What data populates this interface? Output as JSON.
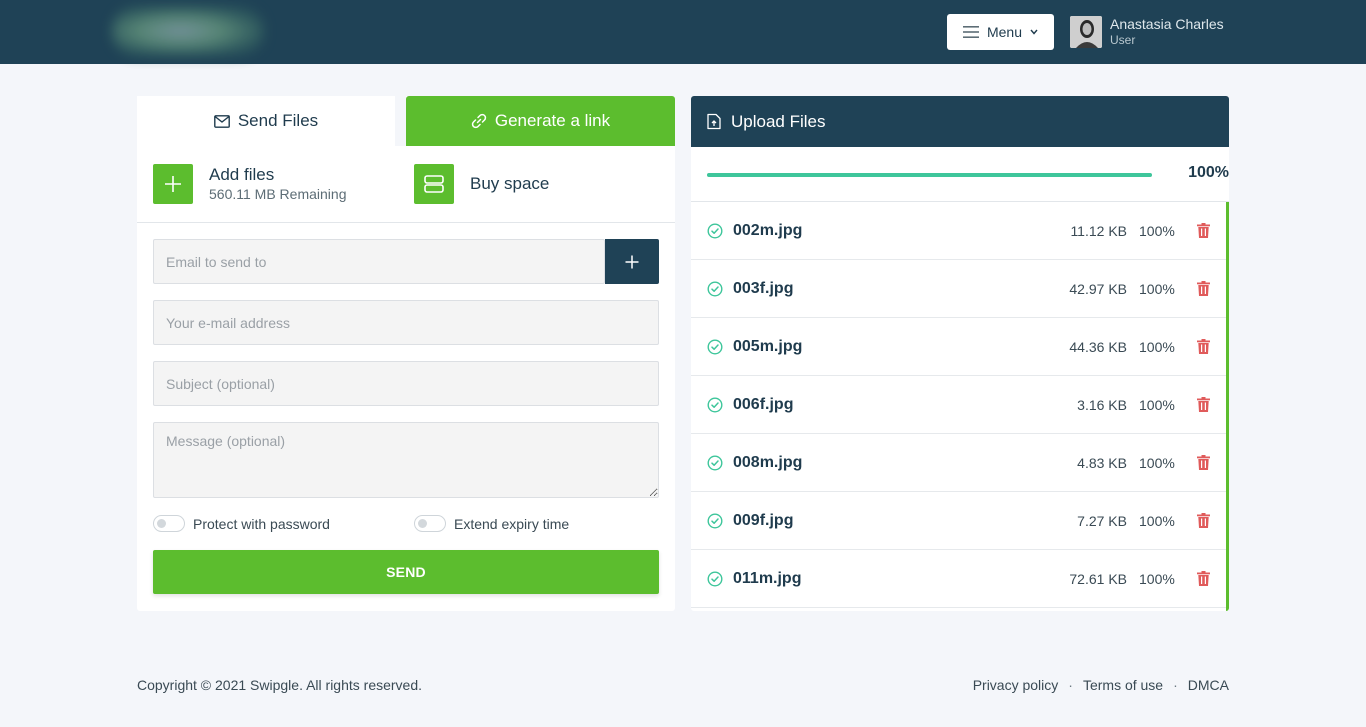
{
  "header": {
    "menu_label": "Menu",
    "user_name": "Anastasia Charles",
    "user_role": "User"
  },
  "send_panel": {
    "tab_send": "Send Files",
    "tab_link": "Generate a link",
    "add_files_title": "Add files",
    "add_files_remaining": "560.11 MB Remaining",
    "buy_space": "Buy space",
    "email_to_placeholder": "Email to send to",
    "your_email_placeholder": "Your e-mail address",
    "subject_placeholder": "Subject (optional)",
    "message_placeholder": "Message (optional)",
    "protect_password": "Protect with password",
    "extend_expiry": "Extend expiry time",
    "send_label": "SEND"
  },
  "upload_panel": {
    "title": "Upload Files",
    "progress_label": "100%",
    "progress_fraction": 1.0,
    "files": [
      {
        "name": "002m.jpg",
        "size": "11.12 KB",
        "pct": "100%"
      },
      {
        "name": "003f.jpg",
        "size": "42.97 KB",
        "pct": "100%"
      },
      {
        "name": "005m.jpg",
        "size": "44.36 KB",
        "pct": "100%"
      },
      {
        "name": "006f.jpg",
        "size": "3.16 KB",
        "pct": "100%"
      },
      {
        "name": "008m.jpg",
        "size": "4.83 KB",
        "pct": "100%"
      },
      {
        "name": "009f.jpg",
        "size": "7.27 KB",
        "pct": "100%"
      },
      {
        "name": "011m.jpg",
        "size": "72.61 KB",
        "pct": "100%"
      }
    ]
  },
  "footer": {
    "copyright": "Copyright © 2021 Swipgle. All rights reserved.",
    "privacy": "Privacy policy",
    "terms": "Terms of use",
    "dmca": "DMCA",
    "separator": "·"
  },
  "colors": {
    "navy": "#1f4256",
    "green": "#5cbd2e",
    "teal": "#3ec69b",
    "danger": "#e05b5b"
  }
}
